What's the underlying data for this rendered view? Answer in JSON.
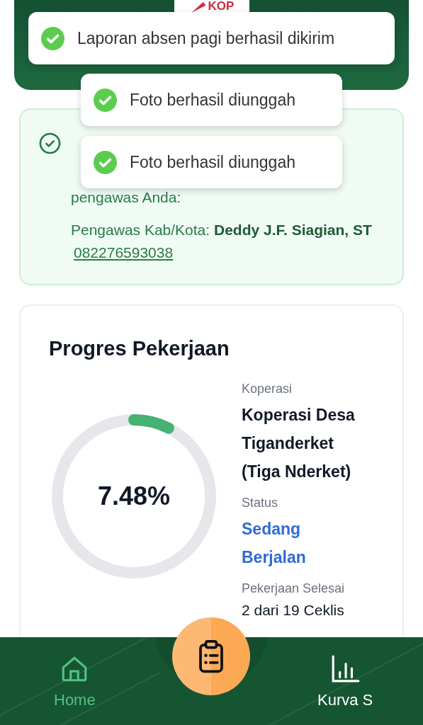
{
  "header": {
    "logo_text": "KOP"
  },
  "toasts": [
    {
      "text": "Laporan absen pagi berhasil dikirim"
    },
    {
      "text": "Foto berhasil diunggah"
    },
    {
      "text": "Foto berhasil diunggah"
    }
  ],
  "notice": {
    "lines": [
      "pengawas Anda:"
    ],
    "supervisor": "Pengawas Kab/Kota: **Deddy J.F. Siagian, ST**",
    "phone": "082276593038"
  },
  "progress": {
    "title": "Progres Pekerjaan",
    "reading": "7.48%",
    "fields": [
      {
        "label": "Koperasi",
        "value": "Koperasi Desa Tiganderket (Tiga Nderket)",
        "kind": "name"
      },
      {
        "label": "Status",
        "value": "Sedang Berjalan",
        "kind": "status"
      },
      {
        "label": "Pekerjaan Selesai",
        "value": "2 dari 19 Ceklis",
        "kind": "plain"
      }
    ]
  },
  "nav": {
    "items": [
      {
        "label": "Home",
        "selected": true
      },
      {
        "label": "Kurva S",
        "selected": false
      }
    ]
  }
}
